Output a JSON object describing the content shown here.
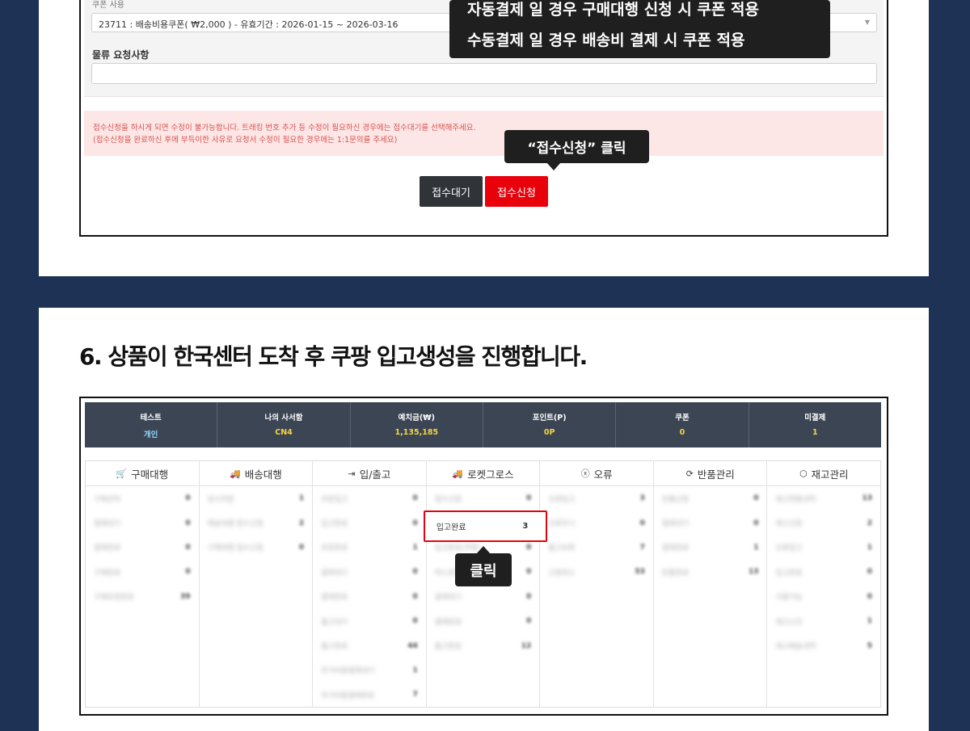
{
  "top": {
    "coupon_label": "쿠폰 사용",
    "coupon_value": "23711 : 배송비용쿠폰( ₩2,000 ) - 유효기간 : 2026-01-15 ~ 2026-03-16",
    "coupon_arrow": "▼",
    "request_label": "물류 요청사항",
    "request_value": "",
    "alert_line1": "접수신청을 하시게 되면 수정이 불가능합니다. 트래킹 번호 추가 등 수정이 필요하신 경우에는 접수대기를 선택해주세요.",
    "alert_line2": "(접수신청을 완료하신 후에 부득이한 사유로 요청서 수정이 필요한 경우에는 1:1문의를 주세요)",
    "btn_wait": "접수대기",
    "btn_apply": "접수신청",
    "callout_pay_line1": "자동결제 일 경우 구매대행 신청 시 쿠폰 적용",
    "callout_pay_line2": "수동결제 일 경우 배송비 결제 시 쿠폰 적용",
    "callout_click": "“접수신청” 클릭"
  },
  "section_title": "6. 상품이 한국센터 도착 후 쿠팡 입고생성을 진행합니다.",
  "stats": [
    {
      "label": "테스트",
      "value": "개인"
    },
    {
      "label": "나의 사서함",
      "value": "CN4"
    },
    {
      "label": "예치금(₩)",
      "value": "1,135,185"
    },
    {
      "label": "포인트(P)",
      "value": "0P"
    },
    {
      "label": "쿠폰",
      "value": "0"
    },
    {
      "label": "미결제",
      "value": "1"
    }
  ],
  "menu": [
    {
      "title": "구매대행",
      "icon": "cart-icon",
      "glyph": "🛒",
      "rows": [
        [
          "구매견적",
          "0"
        ],
        [
          "결제대기",
          "0"
        ],
        [
          "결제완료",
          "0"
        ],
        [
          "구매완료",
          "0"
        ],
        [
          "구매요청완료",
          "39"
        ]
      ]
    },
    {
      "title": "배송대행",
      "icon": "truck-icon",
      "glyph": "🚚",
      "rows": [
        [
          "임시저장",
          "1"
        ],
        [
          "배송대행 접수신청",
          "2"
        ],
        [
          "구매대행 접수신청",
          "0"
        ]
      ]
    },
    {
      "title": "입/출고",
      "icon": "sign-in-icon",
      "glyph": "⇥",
      "rows": [
        [
          "부분입고",
          "0"
        ],
        [
          "입고완료",
          "0"
        ],
        [
          "포장완료",
          "1"
        ],
        [
          "결제대기",
          "0"
        ],
        [
          "결제완료",
          "0"
        ],
        [
          "출고대기",
          "0"
        ],
        [
          "출고완료",
          "44"
        ],
        [
          "추가비용결제대기",
          "1"
        ],
        [
          "추가비용결제완료",
          "7"
        ]
      ]
    },
    {
      "title": "로켓그로스",
      "icon": "truck-icon",
      "glyph": "🚚",
      "rows": [
        [
          "접수신청",
          "0"
        ],
        [
          "입고완료",
          "3"
        ],
        [
          "입고완료(쿠팡)",
          "0"
        ],
        [
          "박스포장완료",
          "0"
        ],
        [
          "결제대기",
          "0"
        ],
        [
          "결제완료",
          "0"
        ],
        [
          "출고완료",
          "12"
        ]
      ]
    },
    {
      "title": "오류",
      "icon": "error-circle-icon",
      "glyph": "ⓧ",
      "rows": [
        [
          "오류입고",
          "3"
        ],
        [
          "오류무시",
          "0"
        ],
        [
          "출고보류",
          "7"
        ],
        [
          "신청취소",
          "53"
        ]
      ]
    },
    {
      "title": "반품관리",
      "icon": "refresh-icon",
      "glyph": "⟳",
      "rows": [
        [
          "반품신청",
          "0"
        ],
        [
          "결제대기",
          "0"
        ],
        [
          "결제완료",
          "1"
        ],
        [
          "반품완료",
          "13"
        ]
      ]
    },
    {
      "title": "재고관리",
      "icon": "box-icon",
      "glyph": "⬡",
      "rows": [
        [
          "재고현황내역",
          "13"
        ],
        [
          "재고신청",
          "2"
        ],
        [
          "오류입고",
          "1"
        ],
        [
          "입고완료",
          "0"
        ],
        [
          "사용가능",
          "0"
        ],
        [
          "재고소진",
          "1"
        ],
        [
          "재고배송내역",
          "5"
        ]
      ]
    }
  ],
  "callout_click2": "클릭"
}
